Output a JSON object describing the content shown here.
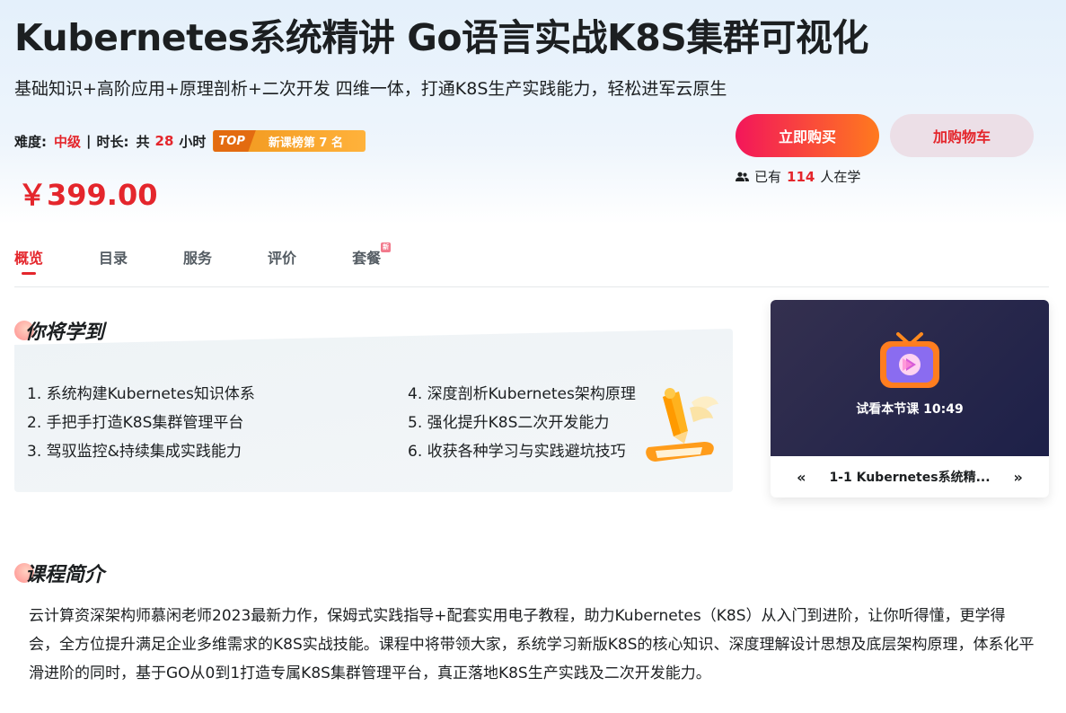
{
  "header": {
    "title": "Kubernetes系统精讲 Go语言实战K8S集群可视化",
    "subtitle": "基础知识+高阶应用+原理剖析+二次开发 四维一体，打通K8S生产实践能力，轻松进军云原生",
    "difficulty_label": "难度:",
    "difficulty_value": "中级",
    "separator": "|",
    "duration_label": "时长:",
    "duration_prefix": "共",
    "duration_value": "28",
    "duration_unit": "小时",
    "rank_top": "TOP",
    "rank_text": "新课榜第 7 名",
    "price": "￥399.00"
  },
  "actions": {
    "buy_label": "立即购买",
    "cart_label": "加购物车",
    "learners_prefix": "已有",
    "learners_count": "114",
    "learners_suffix": "人在学"
  },
  "tabs": [
    {
      "label": "概览",
      "active": true
    },
    {
      "label": "目录",
      "active": false
    },
    {
      "label": "服务",
      "active": false
    },
    {
      "label": "评价",
      "active": false
    },
    {
      "label": "套餐",
      "active": false,
      "badge": "新"
    }
  ],
  "learn": {
    "title": "你将学到",
    "items": [
      "1. 系统构建Kubernetes知识体系",
      "2. 手把手打造K8S集群管理平台",
      "3. 驾驭监控&持续集成实践能力",
      "4. 深度剖析Kubernetes架构原理",
      "5. 强化提升K8S二次开发能力",
      "6. 收获各种学习与实践避坑技巧"
    ]
  },
  "video": {
    "trial_text": "试看本节课 10:49",
    "chapter": "1-1 Kubernetes系统精...",
    "prev": "«",
    "next": "»"
  },
  "intro": {
    "title": "课程简介",
    "text": "云计算资深架构师慕闲老师2023最新力作，保姆式实践指导+配套实用电子教程，助力Kubernetes（K8S）从入门到进阶，让你听得懂，更学得会，全方位提升满足企业多维需求的K8S实战技能。课程中将带领大家，系统学习新版K8S的核心知识、深度理解设计思想及底层架构原理，体系化平滑进阶的同时，基于GO从0到1打造专属K8S集群管理平台，真正落地K8S生产实践及二次开发能力。"
  },
  "colors": {
    "accent_red": "#e4262c",
    "buy_gradient_start": "#f3165a",
    "buy_gradient_end": "#ff7a1e",
    "cart_bg": "#ecdfe7",
    "rank_orange": "#f0961c"
  },
  "icons": [
    "users-icon",
    "tv-play-icon",
    "pen-book-icon"
  ]
}
